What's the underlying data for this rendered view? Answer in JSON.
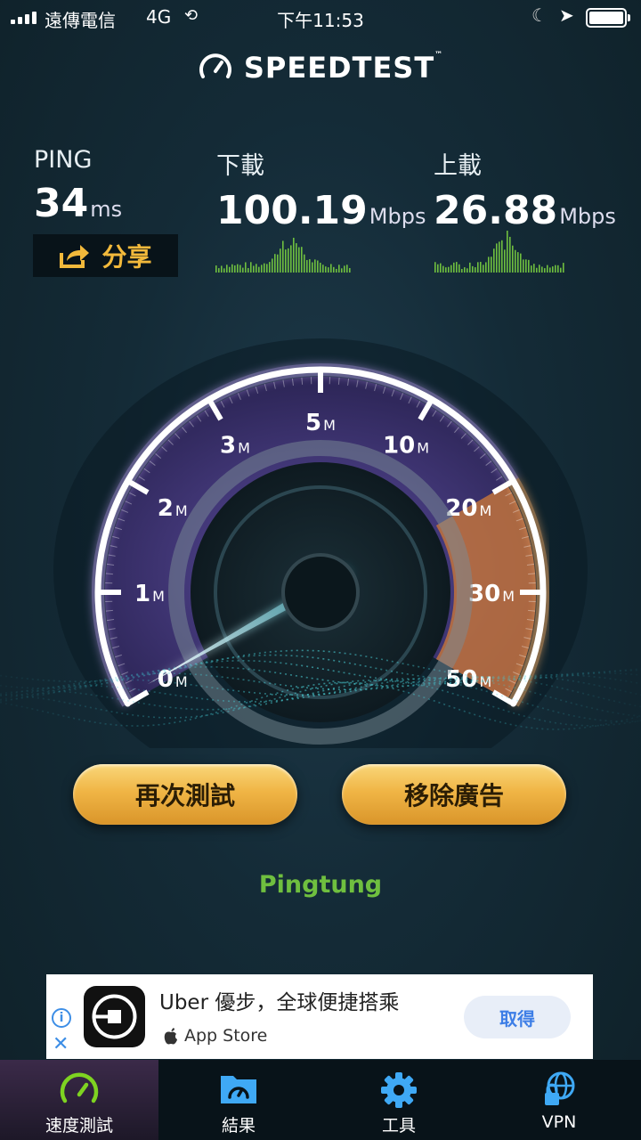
{
  "status_bar": {
    "carrier": "遠傳電信",
    "network": "4G",
    "time": "下午11:53"
  },
  "brand": {
    "name": "SPEEDTEST",
    "tm": "™"
  },
  "results": {
    "ping": {
      "label": "PING",
      "value": "34",
      "unit": "ms"
    },
    "download": {
      "label": "下載",
      "value": "100.19",
      "unit": "Mbps"
    },
    "upload": {
      "label": "上載",
      "value": "26.88",
      "unit": "Mbps"
    }
  },
  "share_label": "分享",
  "gauge": {
    "ticks": [
      "0",
      "1",
      "2",
      "3",
      "5",
      "10",
      "20",
      "30",
      "50"
    ],
    "unit": "M",
    "needle_value": 0,
    "colors": {
      "rim": "#ffffff",
      "face": "#4b3f86",
      "high_zone": "#c9773a"
    }
  },
  "actions": {
    "retest": "再次測試",
    "remove_ads": "移除廣告"
  },
  "server": "Pingtung",
  "ad": {
    "title": "Uber 優步，全球便捷搭乘",
    "store": "App Store",
    "get": "取得"
  },
  "tabs": [
    {
      "label": "速度測試",
      "icon": "speedometer-icon",
      "active": true
    },
    {
      "label": "結果",
      "icon": "results-folder-icon",
      "active": false
    },
    {
      "label": "工具",
      "icon": "gear-icon",
      "active": false
    },
    {
      "label": "VPN",
      "icon": "vpn-lock-icon",
      "active": false
    }
  ],
  "colors": {
    "accent_gold": "#f2b93b",
    "server_green": "#6fbf3f",
    "tab_active": "#7ed321"
  }
}
